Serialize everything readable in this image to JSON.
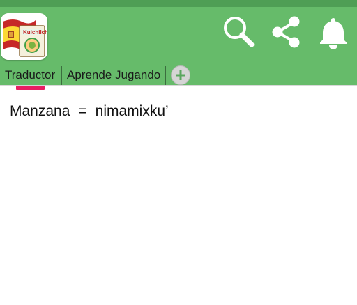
{
  "header": {
    "logo_text": "Kuichilchil",
    "icons": [
      "search-icon",
      "share-icon",
      "bell-icon"
    ],
    "colors": {
      "app_bar": "#66bb6a",
      "status_bar": "#4f9e55",
      "indicator": "#e91e63"
    }
  },
  "tabs": [
    {
      "label": "Traductor",
      "active": true
    },
    {
      "label": "Aprende Jugando",
      "active": false
    }
  ],
  "add_tab_icon": "plus-icon",
  "translation": {
    "source": "Manzana",
    "separator": "=",
    "target": "nimamixku’"
  }
}
